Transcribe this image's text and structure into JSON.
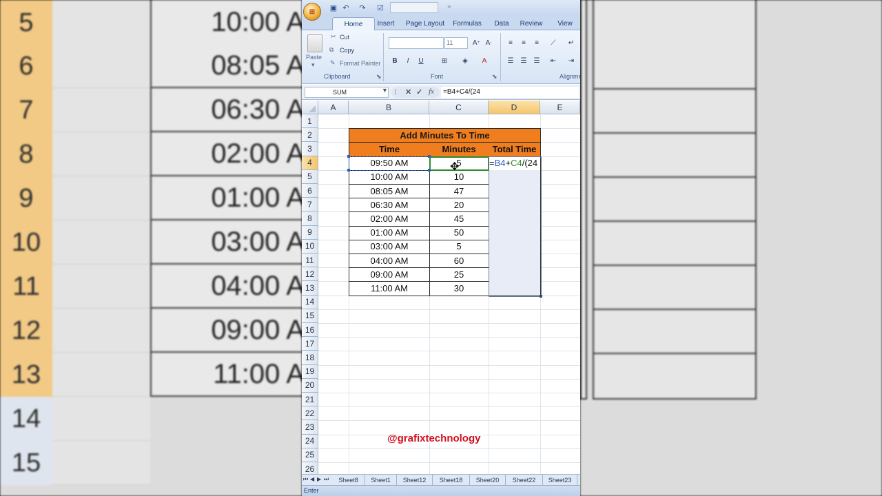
{
  "background": {
    "left_rows": [
      {
        "row": "5",
        "time": "10:00 A",
        "style": "orange"
      },
      {
        "row": "6",
        "time": "08:05 A",
        "style": "orange"
      },
      {
        "row": "7",
        "time": "06:30 A",
        "style": "orange"
      },
      {
        "row": "8",
        "time": "02:00 A",
        "style": "orange"
      },
      {
        "row": "9",
        "time": "01:00 A",
        "style": "orange"
      },
      {
        "row": "10",
        "time": "03:00 A",
        "style": "orange"
      },
      {
        "row": "11",
        "time": "04:00 A",
        "style": "orange"
      },
      {
        "row": "12",
        "time": "09:00 A",
        "style": "orange"
      },
      {
        "row": "13",
        "time": "11:00 A",
        "style": "orange"
      },
      {
        "row": "14",
        "time": "",
        "style": "grey"
      },
      {
        "row": "15",
        "time": "",
        "style": "grey"
      }
    ]
  },
  "ribbon": {
    "office_button": "⊞",
    "tabs": [
      "Home",
      "Insert",
      "Page Layout",
      "Formulas",
      "Data",
      "Review",
      "View"
    ],
    "active_tab": "Home",
    "clipboard": {
      "paste": "Paste",
      "cut": "Cut",
      "copy": "Copy",
      "format_painter": "Format Painter",
      "label": "Clipboard"
    },
    "font": {
      "size": "11",
      "bold": "B",
      "italic": "I",
      "underline": "U",
      "label": "Font"
    },
    "alignment": {
      "label": "Alignme"
    }
  },
  "formula_bar": {
    "name_box": "SUM",
    "fx": "fx",
    "formula": "=B4+C4/(24"
  },
  "grid": {
    "columns": [
      "A",
      "B",
      "C",
      "D",
      "E"
    ],
    "selected_column": "D",
    "selected_row": "4",
    "rows": [
      "1",
      "2",
      "3",
      "4",
      "5",
      "6",
      "7",
      "8",
      "9",
      "10",
      "11",
      "12",
      "13",
      "14",
      "15",
      "16",
      "17",
      "18",
      "19",
      "20",
      "21",
      "22",
      "23",
      "24",
      "25",
      "26"
    ],
    "title": "Add Minutes To Time",
    "headers": [
      "Time",
      "Minutes",
      "Total Time"
    ],
    "data": [
      {
        "time": "09:50 AM",
        "minutes": "5",
        "total": "=B4+C4/(24"
      },
      {
        "time": "10:00 AM",
        "minutes": "10",
        "total": ""
      },
      {
        "time": "08:05 AM",
        "minutes": "47",
        "total": ""
      },
      {
        "time": "06:30 AM",
        "minutes": "20",
        "total": ""
      },
      {
        "time": "02:00 AM",
        "minutes": "45",
        "total": ""
      },
      {
        "time": "01:00 AM",
        "minutes": "50",
        "total": ""
      },
      {
        "time": "03:00 AM",
        "minutes": "5",
        "total": ""
      },
      {
        "time": "04:00 AM",
        "minutes": "60",
        "total": ""
      },
      {
        "time": "09:00 AM",
        "minutes": "25",
        "total": ""
      },
      {
        "time": "11:00 AM",
        "minutes": "30",
        "total": ""
      }
    ],
    "formula_parts": {
      "eq": "=",
      "b4": "B4",
      "plus": "+",
      "c4": "C4",
      "rest": "/(24"
    },
    "watermark": "@grafixtechnology"
  },
  "sheet_tabs": [
    "Sheet8",
    "Sheet1",
    "Sheet12",
    "Sheet18",
    "Sheet20",
    "Sheet22",
    "Sheet23"
  ],
  "status": "Enter",
  "colors": {
    "header_orange": "#f07d1e",
    "ref_blue": "#2e5fc8",
    "ref_green": "#2f8a2f",
    "watermark_red": "#d0101f"
  }
}
